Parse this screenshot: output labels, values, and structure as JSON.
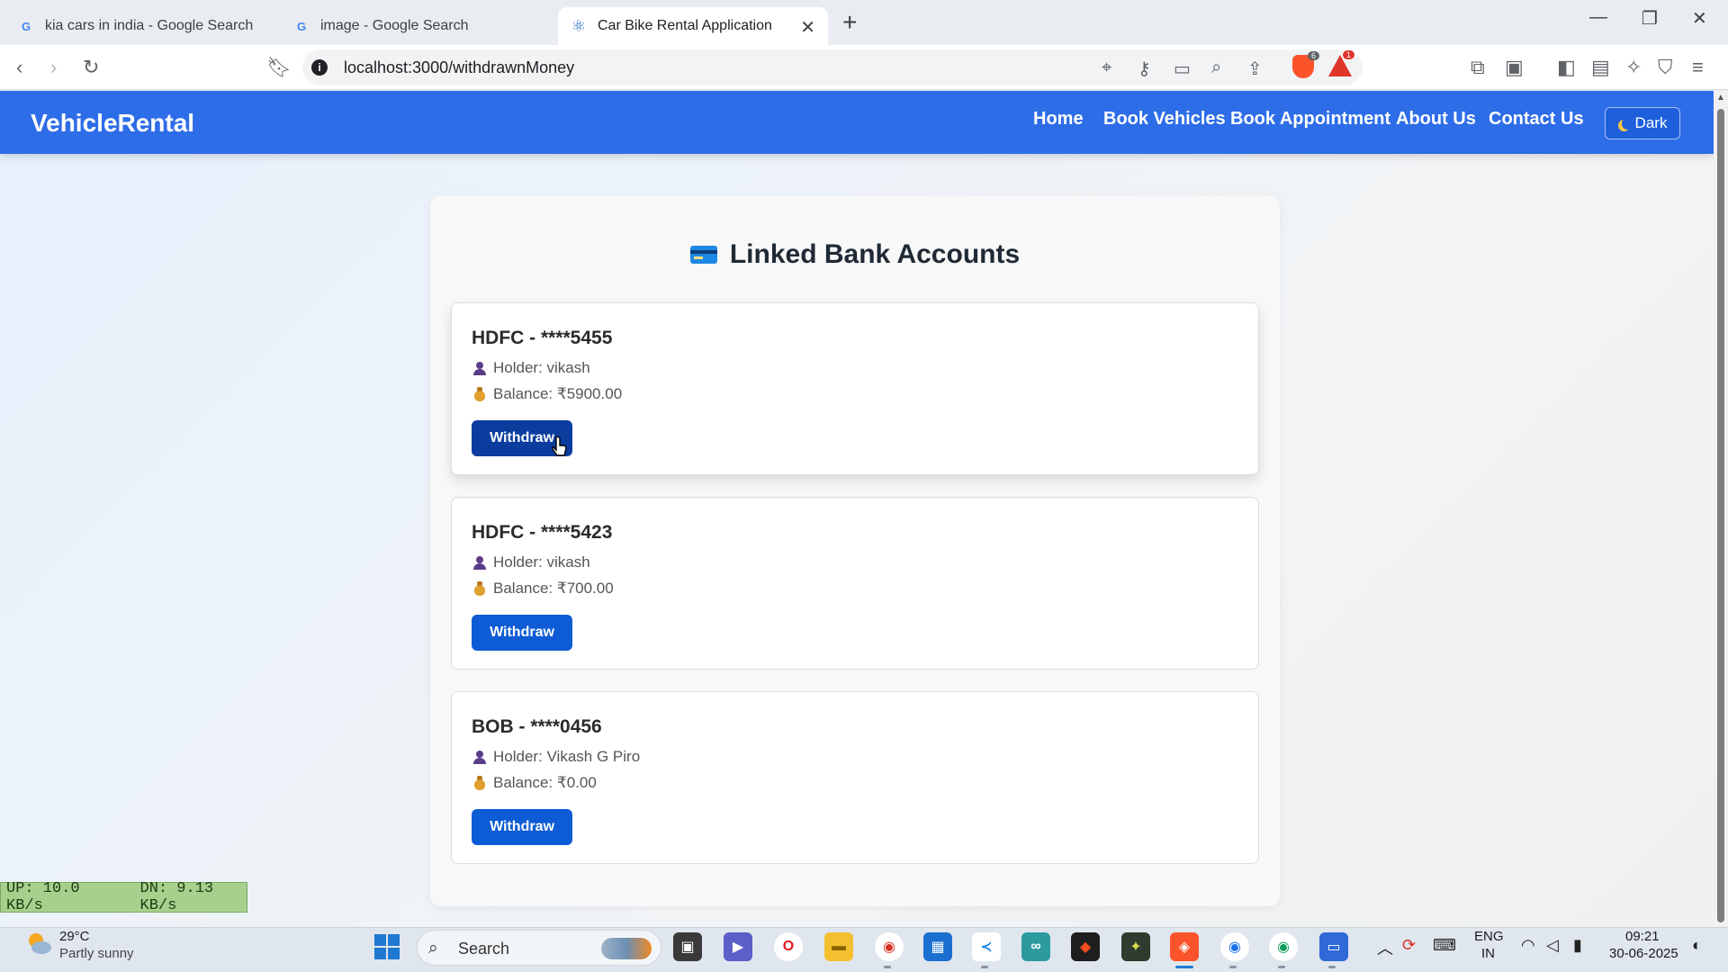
{
  "browser": {
    "tabs": [
      {
        "title": "kia cars in india - Google Search",
        "active": false
      },
      {
        "title": "image - Google Search",
        "active": false
      },
      {
        "title": "Car Bike Rental Application",
        "active": true
      }
    ],
    "url": "localhost:3000/withdrawnMoney",
    "brave_shield_count": "6",
    "rewards_count": "1"
  },
  "navbar": {
    "brand": "VehicleRental",
    "links": [
      "Home",
      "Book Vehicles",
      "Book Appointment",
      "About Us",
      "Contact Us"
    ],
    "theme_button": "Dark"
  },
  "page": {
    "title": "Linked Bank Accounts",
    "accounts": [
      {
        "name": "HDFC - ****5455",
        "holder": "Holder: vikash",
        "balance": "Balance: ₹5900.00",
        "button": "Withdraw"
      },
      {
        "name": "HDFC - ****5423",
        "holder": "Holder: vikash",
        "balance": "Balance: ₹700.00",
        "button": "Withdraw"
      },
      {
        "name": "BOB - ****0456",
        "holder": "Holder: Vikash G Piro",
        "balance": "Balance: ₹0.00",
        "button": "Withdraw"
      }
    ]
  },
  "overlay": {
    "upload": "UP: 10.0 KB/s",
    "download": "DN: 9.13 KB/s"
  },
  "taskbar": {
    "weather_temp": "29°C",
    "weather_desc": "Partly sunny",
    "search_placeholder": "Search",
    "lang_1": "ENG",
    "lang_2": "IN",
    "time": "09:21",
    "date": "30-06-2025"
  },
  "colors": {
    "navbar": "#2e6de8",
    "button": "#0d5cd6",
    "button_hover": "#0a3d9e"
  }
}
